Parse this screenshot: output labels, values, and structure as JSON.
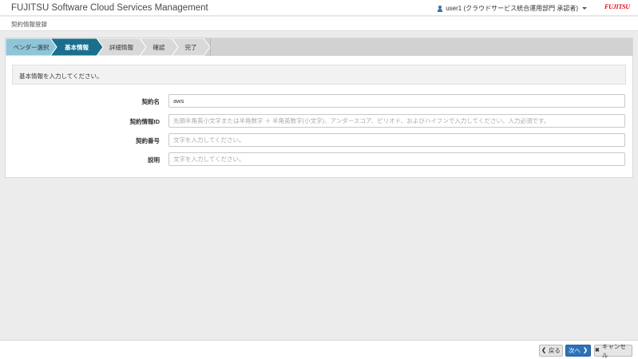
{
  "header": {
    "app_title": "FUJITSU Software Cloud Services Management",
    "user_label": "user1 (クラウドサービス統合運用部門 承認者)",
    "brand": "FUJITSU"
  },
  "breadcrumb": "契約情報登録",
  "steps": [
    {
      "label": "ベンダー選択",
      "state": "done"
    },
    {
      "label": "基本情報",
      "state": "active"
    },
    {
      "label": "詳細情報",
      "state": "pending"
    },
    {
      "label": "確認",
      "state": "pending"
    },
    {
      "label": "完了",
      "state": "pending"
    }
  ],
  "info_message": "基本情報を入力してください。",
  "form": {
    "contract_name": {
      "label": "契約名",
      "value": "aws",
      "placeholder": ""
    },
    "contract_info_id": {
      "label": "契約情報ID",
      "value": "",
      "placeholder": "先頭半角英小文字または半角数字 ＋ 半角英数字(小文字)、アンダースコア、ピリオド、およびハイフンで入力してください。入力必須です。"
    },
    "contract_number": {
      "label": "契約番号",
      "value": "",
      "placeholder": "文字を入力してください。"
    },
    "description": {
      "label": "説明",
      "value": "",
      "placeholder": "文字を入力してください。"
    }
  },
  "footer": {
    "back_label": "戻る",
    "next_label": "次へ",
    "cancel_label": "キャンセル"
  },
  "colors": {
    "step_done": "#8ec5d8",
    "step_active": "#1a6e8e",
    "step_pending": "#d9d9d9",
    "primary_button": "#2e72b8",
    "brand_red": "#e60012"
  },
  "icons": {
    "user": "user-icon",
    "back": "chevron-left-icon",
    "next": "chevron-right-icon",
    "cancel": "close-icon"
  }
}
